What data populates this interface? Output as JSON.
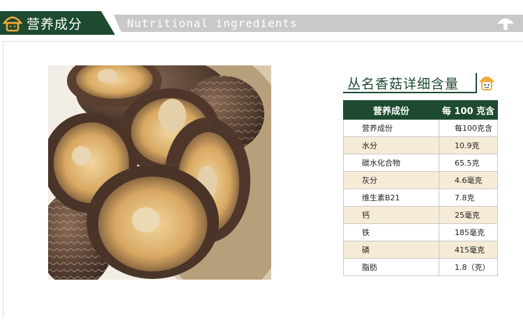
{
  "header": {
    "title_cn": "营养成分",
    "title_en": "Nutritional ingredients",
    "icon": "mushroom-house-icon",
    "right_icon": "mushroom-icon"
  },
  "section": {
    "title": "丛名香菇详细含量",
    "icon": "mushroom-face-icon"
  },
  "photo": {
    "subject": "dried-shiitake-mushrooms-photo"
  },
  "table": {
    "headers": [
      "营养成份",
      "每 100 克含"
    ],
    "rows": [
      [
        "营养成份",
        "每100克含"
      ],
      [
        "水分",
        "10.9克"
      ],
      [
        "碳水化合物",
        "65.5克"
      ],
      [
        "灰分",
        "4.6毫克"
      ],
      [
        "维生素B21",
        "7.8克"
      ],
      [
        "钙",
        "25毫克"
      ],
      [
        "铁",
        "185毫克"
      ],
      [
        "磷",
        "415毫克"
      ],
      [
        "脂肪",
        "1.8（克）"
      ]
    ]
  },
  "colors": {
    "brand_green": "#1d4a30",
    "banner_gray": "#c9c9c9",
    "row_tint": "#f6ebd6"
  }
}
